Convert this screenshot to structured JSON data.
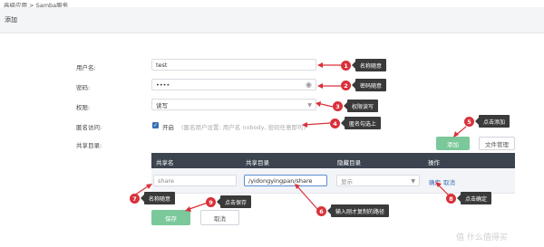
{
  "breadcrumb": "高级应用 > Samba服务",
  "page_title": "添加",
  "form": {
    "username_label": "用户名:",
    "username_value": "test",
    "password_label": "密码:",
    "password_value": "••••",
    "permission_label": "权限:",
    "permission_value": "读写",
    "anonymous_label": "匿名访问:",
    "anonymous_toggle": "开启",
    "anonymous_hint": "(匿名用户设置: 用户名 nobody, 密码任意即可)",
    "shared_dir_label": "共享目录:"
  },
  "buttons": {
    "add": "添加",
    "file_manager": "文件管理",
    "save": "保存",
    "cancel": "取消"
  },
  "table": {
    "headers": [
      "共享名",
      "共享目录",
      "隐藏目录",
      "操作"
    ],
    "row": {
      "share_name": "share",
      "share_dir": "/yidongyingpan/share",
      "hidden": "显示",
      "confirm": "确定",
      "cancel": "取消"
    }
  },
  "annotations": [
    {
      "num": "1",
      "text": "名称随意"
    },
    {
      "num": "2",
      "text": "密码随意"
    },
    {
      "num": "3",
      "text": "权限读写"
    },
    {
      "num": "4",
      "text": "匿名勾选上"
    },
    {
      "num": "5",
      "text": "点击添加"
    },
    {
      "num": "6",
      "text": "输入刚才复制的路径"
    },
    {
      "num": "7",
      "text": "名称随意"
    },
    {
      "num": "8",
      "text": "点击确定"
    },
    {
      "num": "9",
      "text": "点击保存"
    }
  ],
  "watermark": "值 什么值得买",
  "colors": {
    "accent_green": "#7bc89a",
    "annotation_red": "#d9313a",
    "table_header": "#3c4450",
    "link_blue": "#3b6fb6"
  }
}
